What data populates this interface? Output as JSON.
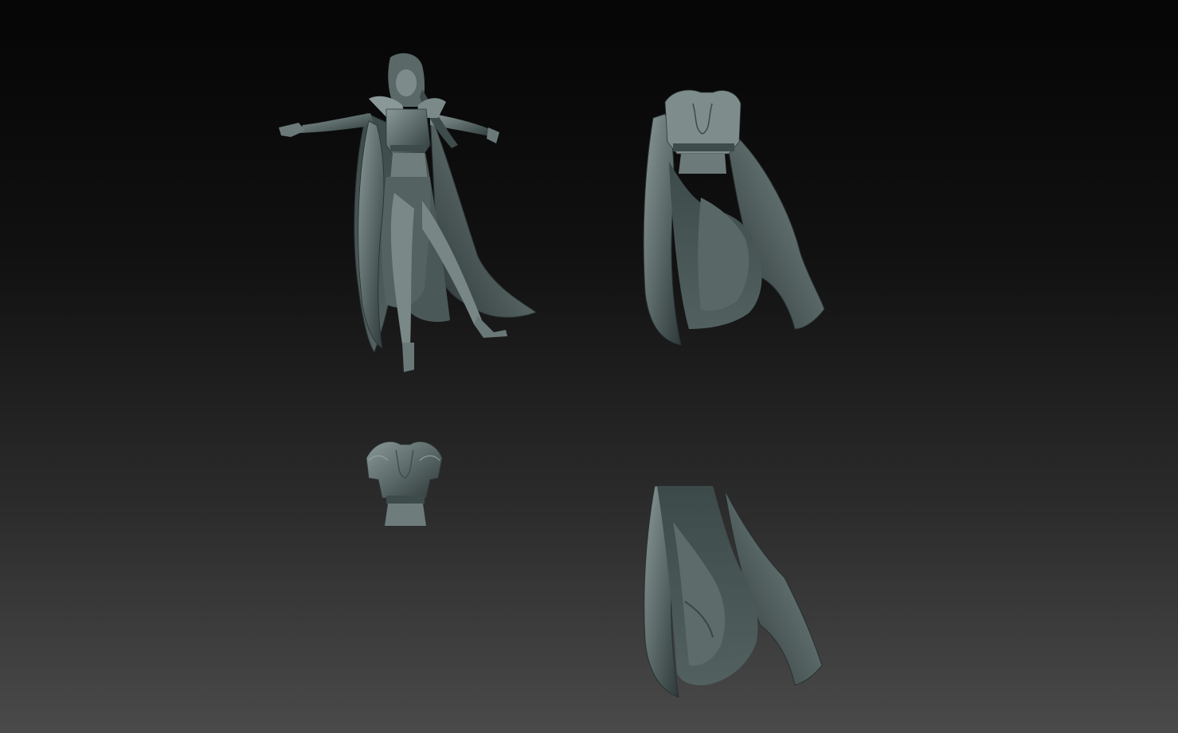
{
  "viewport": {
    "background_top": "#050505",
    "background_bottom": "#4a4a4a"
  },
  "material": {
    "base_color": "#5c6a6a",
    "shadow_color": "#2e3838",
    "highlight_color": "#8a9898"
  },
  "models": [
    {
      "name": "full-figure",
      "icon": "figure-mesh"
    },
    {
      "name": "coat-and-top",
      "icon": "coat-mesh"
    },
    {
      "name": "top-only",
      "icon": "top-mesh"
    },
    {
      "name": "cape-only",
      "icon": "cape-mesh"
    }
  ]
}
